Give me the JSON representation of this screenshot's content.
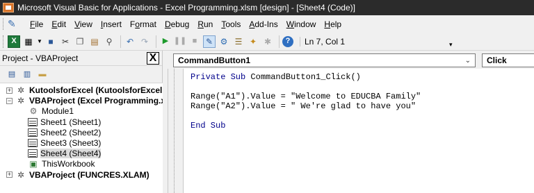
{
  "window": {
    "title": "Microsoft Visual Basic for Applications - Excel Programming.xlsm [design] - [Sheet4 (Code)]"
  },
  "menubar": {
    "items": [
      {
        "label": "File",
        "mnemonic": "F",
        "rest": "ile"
      },
      {
        "label": "Edit",
        "mnemonic": "E",
        "rest": "dit"
      },
      {
        "label": "View",
        "mnemonic": "V",
        "rest": "iew"
      },
      {
        "label": "Insert",
        "mnemonic": "I",
        "rest": "nsert"
      },
      {
        "label": "Format",
        "mnemonic": "o",
        "pre": "F",
        "rest": "rmat"
      },
      {
        "label": "Debug",
        "mnemonic": "D",
        "rest": "ebug"
      },
      {
        "label": "Run",
        "mnemonic": "R",
        "rest": "un"
      },
      {
        "label": "Tools",
        "mnemonic": "T",
        "rest": "ools"
      },
      {
        "label": "Add-Ins",
        "mnemonic": "A",
        "rest": "dd-Ins"
      },
      {
        "label": "Window",
        "mnemonic": "W",
        "rest": "indow"
      },
      {
        "label": "Help",
        "mnemonic": "H",
        "rest": "elp"
      }
    ]
  },
  "toolbar": {
    "position": "Ln 7, Col 1",
    "icons": [
      "excel-icon",
      "insert-module-icon",
      "save-icon",
      "cut-icon",
      "copy-icon",
      "paste-icon",
      "find-icon",
      "undo-icon",
      "redo-icon",
      "run-icon",
      "break-icon",
      "reset-icon",
      "design-mode-icon",
      "project-explorer-icon",
      "properties-icon",
      "object-browser-icon",
      "toolbox-icon",
      "help-icon"
    ]
  },
  "project_pane": {
    "title": "Project - VBAProject",
    "close_glyph": "X",
    "tree": [
      {
        "label": "KutoolsforExcel (KutoolsforExcel.xla",
        "level": 0,
        "expander": "+",
        "bold": true,
        "icon": "vba-project-icon"
      },
      {
        "label": "VBAProject (Excel Programming.xlsi",
        "level": 0,
        "expander": "−",
        "bold": true,
        "icon": "vba-project-icon"
      },
      {
        "label": "Module1",
        "level": 1,
        "expander": "",
        "bold": false,
        "icon": "module-icon"
      },
      {
        "label": "Sheet1 (Sheet1)",
        "level": 1,
        "expander": "",
        "bold": false,
        "icon": "sheet-icon"
      },
      {
        "label": "Sheet2 (Sheet2)",
        "level": 1,
        "expander": "",
        "bold": false,
        "icon": "sheet-icon"
      },
      {
        "label": "Sheet3 (Sheet3)",
        "level": 1,
        "expander": "",
        "bold": false,
        "icon": "sheet-icon"
      },
      {
        "label": "Sheet4 (Sheet4)",
        "level": 1,
        "expander": "",
        "bold": false,
        "icon": "sheet-icon",
        "selected": true
      },
      {
        "label": "ThisWorkbook",
        "level": 1,
        "expander": "",
        "bold": false,
        "icon": "workbook-icon"
      },
      {
        "label": "VBAProject (FUNCRES.XLAM)",
        "level": 0,
        "expander": "+",
        "bold": true,
        "icon": "vba-project-icon"
      }
    ]
  },
  "code_window": {
    "object_dropdown": "CommandButton1",
    "procedure_dropdown": "Click",
    "lines": [
      "Private Sub CommandButton1_Click()",
      "",
      "Range(\"A1\").Value = \"Welcome to EDUCBA Family\"",
      "Range(\"A2\").Value = \" We're glad to have you\"",
      "",
      "End Sub"
    ]
  },
  "colors": {
    "titlebar_bg": "#2b2b2b",
    "keyword": "#00008b",
    "chrome_bg": "#f0f0f0"
  }
}
